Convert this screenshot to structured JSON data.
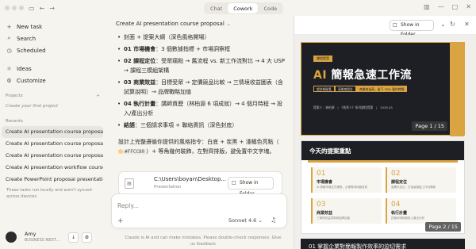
{
  "topbar": {
    "tabs": [
      "Chat",
      "Cowork",
      "Code"
    ],
    "active_tab": "Cowork"
  },
  "sidebar": {
    "nav": [
      {
        "label": "New task",
        "icon": "plus-icon"
      },
      {
        "label": "Search",
        "icon": "search-icon"
      },
      {
        "label": "Scheduled",
        "icon": "clock-icon"
      },
      {
        "label": "Ideas",
        "icon": "bulb-icon"
      },
      {
        "label": "Customize",
        "icon": "customize-icon"
      }
    ],
    "projects_label": "Projects",
    "projects_placeholder": "Create your first project",
    "recents_label": "Recents",
    "recents": [
      "Create AI presentation course proposal",
      "Create AI presentation course proposal",
      "Create AI presentation course proposal",
      "Create AI presentation workflow course",
      "Create PowerPoint proposal presentation"
    ],
    "note": "These tasks run locally and aren't synced across devices",
    "user": {
      "name": "Amy",
      "plan": "BUSINESS NEXT..."
    }
  },
  "chat": {
    "title": "Create AI presentation course proposal",
    "bullets": [
      {
        "label": "",
        "text": "封面 + 提案大綱（深色風格開場）"
      },
      {
        "label": "01 市場機會",
        "text": "：3 個數據指標 + 市場洞察框"
      },
      {
        "label": "02 課程定位",
        "text": "：受眾痛點 → 舊流程 vs. 新工作流對比 → 4 大 USP → 課程三模組架構"
      },
      {
        "label": "03 商業效益",
        "text": "：目標受眾 → 定價競品比較 → 三情境收益圖表（含試算說明）→ 品牌戰略加值"
      },
      {
        "label": "04 執行計畫",
        "text": "：講師資歷（林柏源 6 項成就）→ 4 個月時程 → 投入/產出分析"
      },
      {
        "label": "結語",
        "text": "：三個請求事項 + 聯絡資訊（深色封底）"
      }
    ],
    "para_before": "設計上完整遵循你提供的風格指令：白底 + 炭黑 + 淺橘色亮點（",
    "para_code": "#FFCC80",
    "para_after": "）+ 等角幾何裝飾，左對齊排版，避免置中文字塊。",
    "file": {
      "path": "C:\\Users\\boyan\\Desktop...",
      "type": "Presentation",
      "button": "Show in Folder"
    },
    "input_placeholder": "Reply...",
    "model": "Sonnet 4.6",
    "disclaimer": "Claude is AI and can make mistakes. Please double-check responses. Give us feedback"
  },
  "preview": {
    "show_in_folder": "Show in Folder",
    "slide1": {
      "tag": "課程提案",
      "title_ai": "AI",
      "title_rest": " 簡報急速工作流",
      "bar": [
        "超詳細秘笈",
        "高質感設計",
        "商業效益高，省下 70% 製作時間"
      ],
      "meta": "提案人：林柏源　|　《效率人》系列課程提案　|　2026.05",
      "page": "Page 1 / 15"
    },
    "slide2": {
      "title": "今天的提案重點",
      "cards": [
        {
          "num": "01",
          "title": "市場機會",
          "desc": "AI 簡報市場正在爆發，企業需求持續成長"
        },
        {
          "num": "02",
          "title": "課程定位",
          "desc": "差異化定位，打造高價值工作流課程"
        },
        {
          "num": "03",
          "title": "商業效益",
          "desc": "三情境收益試算與品牌加值"
        },
        {
          "num": "04",
          "title": "執行計畫",
          "desc": "四個月時程與投入產出分析"
        }
      ],
      "page": "Page 2 / 15"
    },
    "slide3": {
      "title": "01 掌握企業對簡報製作效率的迫切需求"
    }
  }
}
